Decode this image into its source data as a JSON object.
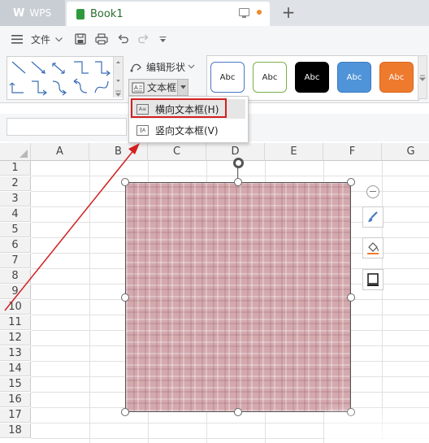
{
  "titlebar": {
    "app_name": "WPS",
    "app_logo": "W",
    "doc_tab": "Book1",
    "unsaved_dot_color": "#f08a2c"
  },
  "menubar": {
    "file_menu": "文件",
    "icons": [
      "menu-icon",
      "chevron-down-icon",
      "save-icon",
      "print-icon",
      "undo-icon",
      "redo-icon",
      "more-icon"
    ]
  },
  "ribbon": {
    "edit_shape": "编辑形状",
    "textbox": "文本框",
    "style_gallery": [
      {
        "label": "Abc",
        "fill": "#ffffff",
        "border": "#4a78c2",
        "text": "#222222"
      },
      {
        "label": "Abc",
        "fill": "#ffffff",
        "border": "#79b04a",
        "text": "#222222"
      },
      {
        "label": "Abc",
        "fill": "#000000",
        "border": "#000000",
        "text": "#ffffff"
      },
      {
        "label": "Abc",
        "fill": "#4f93d8",
        "border": "#3d7dc0",
        "text": "#ffffff"
      },
      {
        "label": "Abc",
        "fill": "#ee7a2e",
        "border": "#d9661c",
        "text": "#ffffff"
      }
    ]
  },
  "dropdown": {
    "items": [
      {
        "label": "横向文本框(H)",
        "icon": "horizontal-textbox-icon",
        "highlighted": true
      },
      {
        "label": "竖向文本框(V)",
        "icon": "vertical-textbox-icon",
        "highlighted": false
      }
    ]
  },
  "grid": {
    "columns": [
      "A",
      "B",
      "C",
      "D",
      "E",
      "F",
      "G"
    ],
    "rows": [
      "1",
      "2",
      "3",
      "4",
      "5",
      "6",
      "7",
      "8",
      "9",
      "10",
      "11",
      "12",
      "13",
      "14",
      "15",
      "16",
      "17",
      "18"
    ]
  },
  "colors": {
    "accent_red": "#d32020",
    "shape_fill": "#d3a9ae",
    "tab_green": "#2b6e2f"
  }
}
